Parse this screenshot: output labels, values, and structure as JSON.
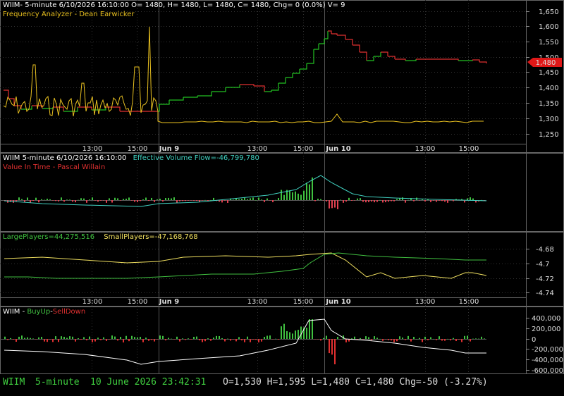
{
  "panel1": {
    "title": "WIIM- 5-minute 6/10/2026 16:10:00 O= 1480, H= 1480, L= 1480, C= 1480, Chg= 0 (0.0%) V= 9",
    "indicator": "Frequency Analyzer - Dean Earwicker",
    "y_ticks": [
      "1,650",
      "1,600",
      "1,550",
      "1,500",
      "1,450",
      "1,400",
      "1,350",
      "1,300",
      "1,250"
    ],
    "last_price": "1,480",
    "colors": {
      "up": "#22c022",
      "down": "#e03030",
      "analyzer": "#e8c020",
      "marker": "#e01818"
    }
  },
  "time_axis": [
    "13:00",
    "15:00",
    "Jun 9",
    "13:00",
    "15:00",
    "Jun 10",
    "13:00",
    "15:00"
  ],
  "panel2": {
    "title": "WIIM 5-minute  6/10/2026 16:10:00",
    "indicator": "Effective Volume Flow=-46,799,780",
    "indicator2": "Value In Time - Pascal Willain",
    "colors": {
      "flow": "#40d0c0",
      "up": "#40c040",
      "down": "#e04050",
      "title2": "#e03030"
    }
  },
  "panel3": {
    "large": "LargePlayers=44,275,516",
    "small": "SmallPlayers=-47,168,768",
    "y_ticks": [
      "-4.68",
      "-4.7",
      "-4.72",
      "-4.74"
    ],
    "colors": {
      "large": "#40c040",
      "small": "#f0e060"
    }
  },
  "panel4": {
    "title_prefix": "WIIM - ",
    "buy": "BuyUp",
    "sep": "-",
    "sell": "SellDown",
    "y_ticks": [
      "400,000",
      "200,000",
      "0",
      "-200,000",
      "-400,000",
      "-600,000"
    ],
    "colors": {
      "buy": "#40c040",
      "sell": "#e03030",
      "line": "#ffffff"
    }
  },
  "status": {
    "symbol": "WIIM",
    "interval": "5-minute",
    "datetime": "10 June 2026 23:42:31",
    "ohlc": "O=1,530  H=1,595  L=1,480  C=1,480  Chg=-50 (-3.27%)"
  }
}
